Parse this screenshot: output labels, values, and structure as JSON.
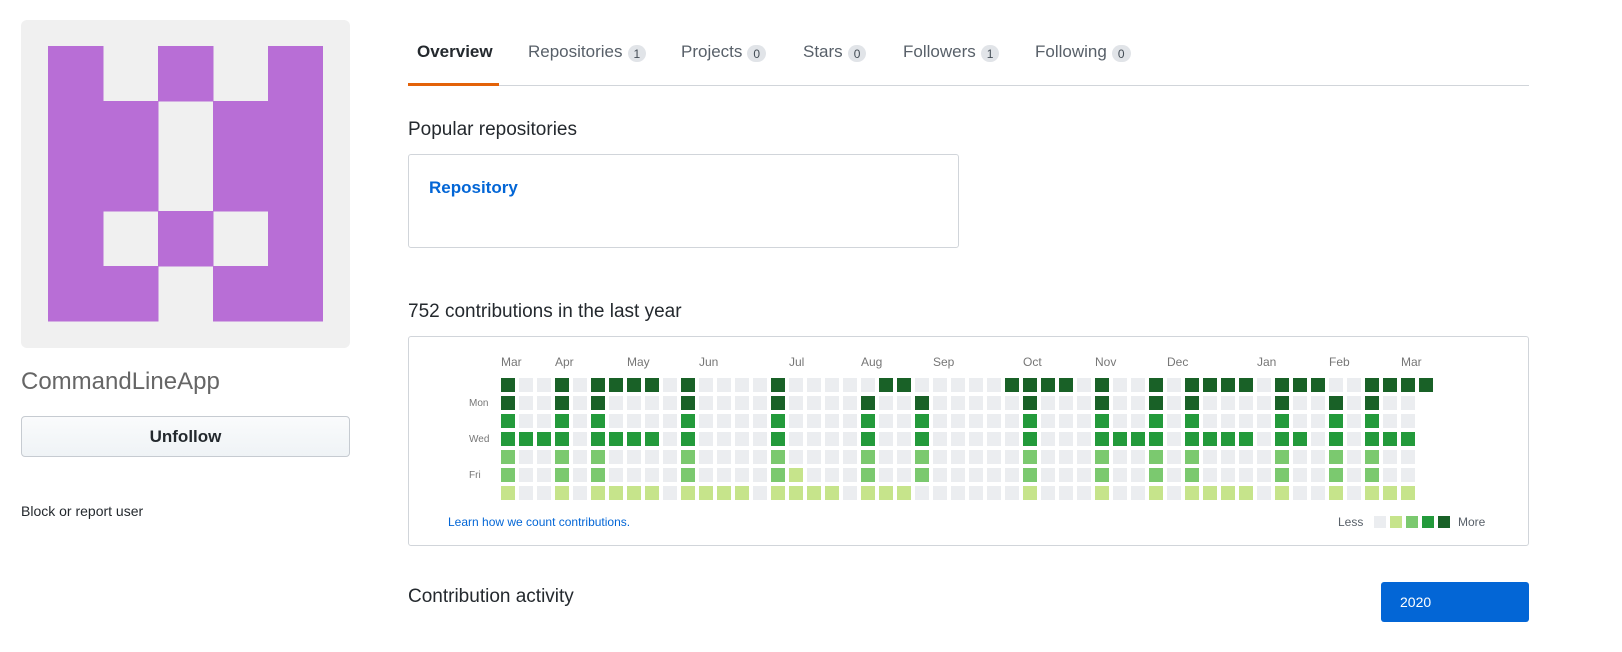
{
  "profile": {
    "name": "CommandLineApp",
    "unfollow_label": "Unfollow",
    "block_label": "Block or report user",
    "avatar_color": "#b86ed6",
    "avatar_bg": "#f0f0f0",
    "avatar_pattern": [
      "X.X.X",
      "XX.XX",
      "XX.XX",
      "X.X.X",
      "XX.XX"
    ]
  },
  "tabs": [
    {
      "label": "Overview",
      "count": null,
      "selected": true
    },
    {
      "label": "Repositories",
      "count": "1",
      "selected": false
    },
    {
      "label": "Projects",
      "count": "0",
      "selected": false
    },
    {
      "label": "Stars",
      "count": "0",
      "selected": false
    },
    {
      "label": "Followers",
      "count": "1",
      "selected": false
    },
    {
      "label": "Following",
      "count": "0",
      "selected": false
    }
  ],
  "popular": {
    "title": "Popular repositories",
    "repos": [
      {
        "name": "Repository"
      }
    ]
  },
  "contributions": {
    "title": "752 contributions in the last year",
    "learn_link": "Learn how we count contributions.",
    "legend_less": "Less",
    "legend_more": "More",
    "colors": [
      "#ebedf0",
      "#c6e48b",
      "#7bc96f",
      "#239a3b",
      "#196127"
    ],
    "months": [
      {
        "label": "Mar",
        "week": 0
      },
      {
        "label": "Apr",
        "week": 3
      },
      {
        "label": "May",
        "week": 7
      },
      {
        "label": "Jun",
        "week": 11
      },
      {
        "label": "Jul",
        "week": 16
      },
      {
        "label": "Aug",
        "week": 20
      },
      {
        "label": "Sep",
        "week": 24
      },
      {
        "label": "Oct",
        "week": 29
      },
      {
        "label": "Nov",
        "week": 33
      },
      {
        "label": "Dec",
        "week": 37
      },
      {
        "label": "Jan",
        "week": 42
      },
      {
        "label": "Feb",
        "week": 46
      },
      {
        "label": "Mar",
        "week": 50
      }
    ],
    "day_labels": [
      {
        "label": "Mon",
        "row": 1
      },
      {
        "label": "Wed",
        "row": 3
      },
      {
        "label": "Fri",
        "row": 5
      }
    ],
    "weeks": [
      [
        4,
        4,
        3,
        3,
        2,
        2,
        1
      ],
      [
        0,
        0,
        0,
        3,
        0,
        0,
        0
      ],
      [
        0,
        0,
        0,
        3,
        0,
        0,
        0
      ],
      [
        4,
        4,
        3,
        3,
        2,
        2,
        1
      ],
      [
        0,
        0,
        0,
        0,
        0,
        0,
        0
      ],
      [
        4,
        4,
        3,
        3,
        2,
        2,
        1
      ],
      [
        4,
        0,
        0,
        3,
        0,
        0,
        1
      ],
      [
        4,
        0,
        0,
        3,
        0,
        0,
        1
      ],
      [
        4,
        0,
        0,
        3,
        0,
        0,
        1
      ],
      [
        0,
        0,
        0,
        0,
        0,
        0,
        0
      ],
      [
        4,
        4,
        3,
        3,
        2,
        2,
        1
      ],
      [
        0,
        0,
        0,
        0,
        0,
        0,
        1
      ],
      [
        0,
        0,
        0,
        0,
        0,
        0,
        1
      ],
      [
        0,
        0,
        0,
        0,
        0,
        0,
        1
      ],
      [
        0,
        0,
        0,
        0,
        0,
        0,
        0
      ],
      [
        4,
        4,
        3,
        3,
        2,
        2,
        1
      ],
      [
        0,
        0,
        0,
        0,
        0,
        1,
        1
      ],
      [
        0,
        0,
        0,
        0,
        0,
        0,
        1
      ],
      [
        0,
        0,
        0,
        0,
        0,
        0,
        1
      ],
      [
        0,
        0,
        0,
        0,
        0,
        0,
        0
      ],
      [
        0,
        4,
        3,
        3,
        2,
        2,
        1
      ],
      [
        4,
        0,
        0,
        0,
        0,
        0,
        1
      ],
      [
        4,
        0,
        0,
        0,
        0,
        0,
        1
      ],
      [
        0,
        4,
        3,
        3,
        2,
        2,
        0
      ],
      [
        0,
        0,
        0,
        0,
        0,
        0,
        0
      ],
      [
        0,
        0,
        0,
        0,
        0,
        0,
        0
      ],
      [
        0,
        0,
        0,
        0,
        0,
        0,
        0
      ],
      [
        0,
        0,
        0,
        0,
        0,
        0,
        0
      ],
      [
        4,
        0,
        0,
        0,
        0,
        0,
        0
      ],
      [
        4,
        4,
        3,
        3,
        2,
        2,
        1
      ],
      [
        4,
        0,
        0,
        0,
        0,
        0,
        0
      ],
      [
        4,
        0,
        0,
        0,
        0,
        0,
        0
      ],
      [
        0,
        0,
        0,
        0,
        0,
        0,
        0
      ],
      [
        4,
        4,
        3,
        3,
        2,
        2,
        1
      ],
      [
        0,
        0,
        0,
        3,
        0,
        0,
        0
      ],
      [
        0,
        0,
        0,
        3,
        0,
        0,
        0
      ],
      [
        4,
        4,
        3,
        3,
        2,
        2,
        1
      ],
      [
        0,
        0,
        0,
        0,
        0,
        0,
        0
      ],
      [
        4,
        4,
        3,
        3,
        2,
        2,
        1
      ],
      [
        4,
        0,
        0,
        3,
        0,
        0,
        1
      ],
      [
        4,
        0,
        0,
        3,
        0,
        0,
        1
      ],
      [
        4,
        0,
        0,
        3,
        0,
        0,
        1
      ],
      [
        0,
        0,
        0,
        0,
        0,
        0,
        0
      ],
      [
        4,
        4,
        3,
        3,
        2,
        2,
        1
      ],
      [
        4,
        0,
        0,
        3,
        0,
        0,
        0
      ],
      [
        4,
        0,
        0,
        0,
        0,
        0,
        0
      ],
      [
        0,
        4,
        3,
        3,
        2,
        2,
        1
      ],
      [
        0,
        0,
        0,
        0,
        0,
        0,
        0
      ],
      [
        4,
        4,
        3,
        3,
        2,
        2,
        1
      ],
      [
        4,
        0,
        0,
        3,
        0,
        0,
        1
      ],
      [
        4,
        0,
        0,
        3,
        0,
        0,
        1
      ],
      [
        4,
        null,
        null,
        null,
        null,
        null,
        null
      ]
    ]
  },
  "activity": {
    "title": "Contribution activity",
    "year_label": "2020"
  }
}
